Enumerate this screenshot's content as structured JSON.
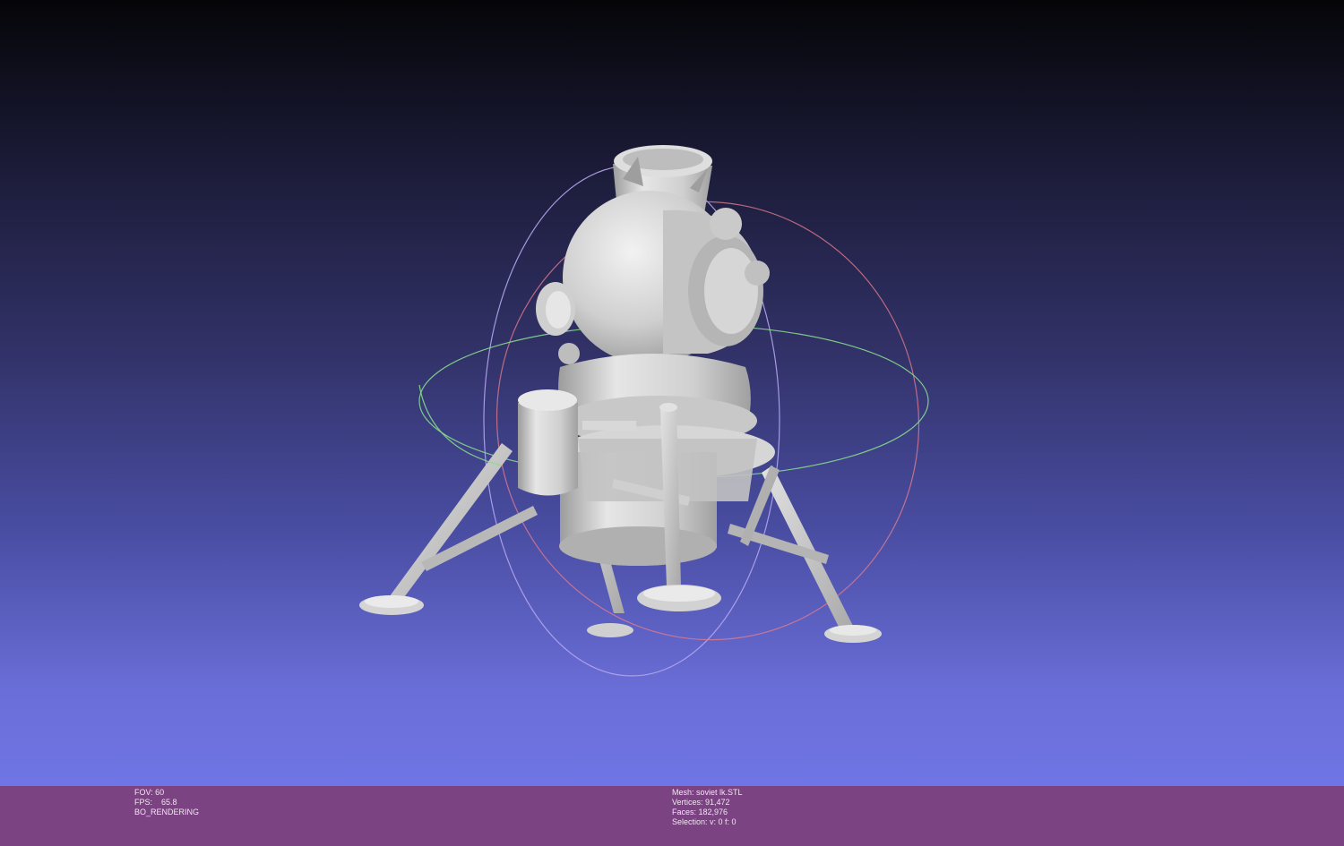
{
  "viewer": {
    "mesh_name": "soviet lk.STL",
    "colors": {
      "background_top": "#050508",
      "background_bottom": "#7075e6",
      "model": "#c9c9c9",
      "statusbar": "#7b4381",
      "trackball_x": "#e86a7a",
      "trackball_y": "#7fe07f",
      "trackball_z": "#b0a0f0"
    }
  },
  "status_left": {
    "fov": "FOV: 60",
    "fps": "FPS:    65.8",
    "mode": "BO_RENDERING"
  },
  "status_right": {
    "mesh": "Mesh: soviet lk.STL",
    "vertices": "Vertices: 91,472",
    "faces": "Faces: 182,976",
    "selection": "Selection: v: 0 f: 0"
  }
}
